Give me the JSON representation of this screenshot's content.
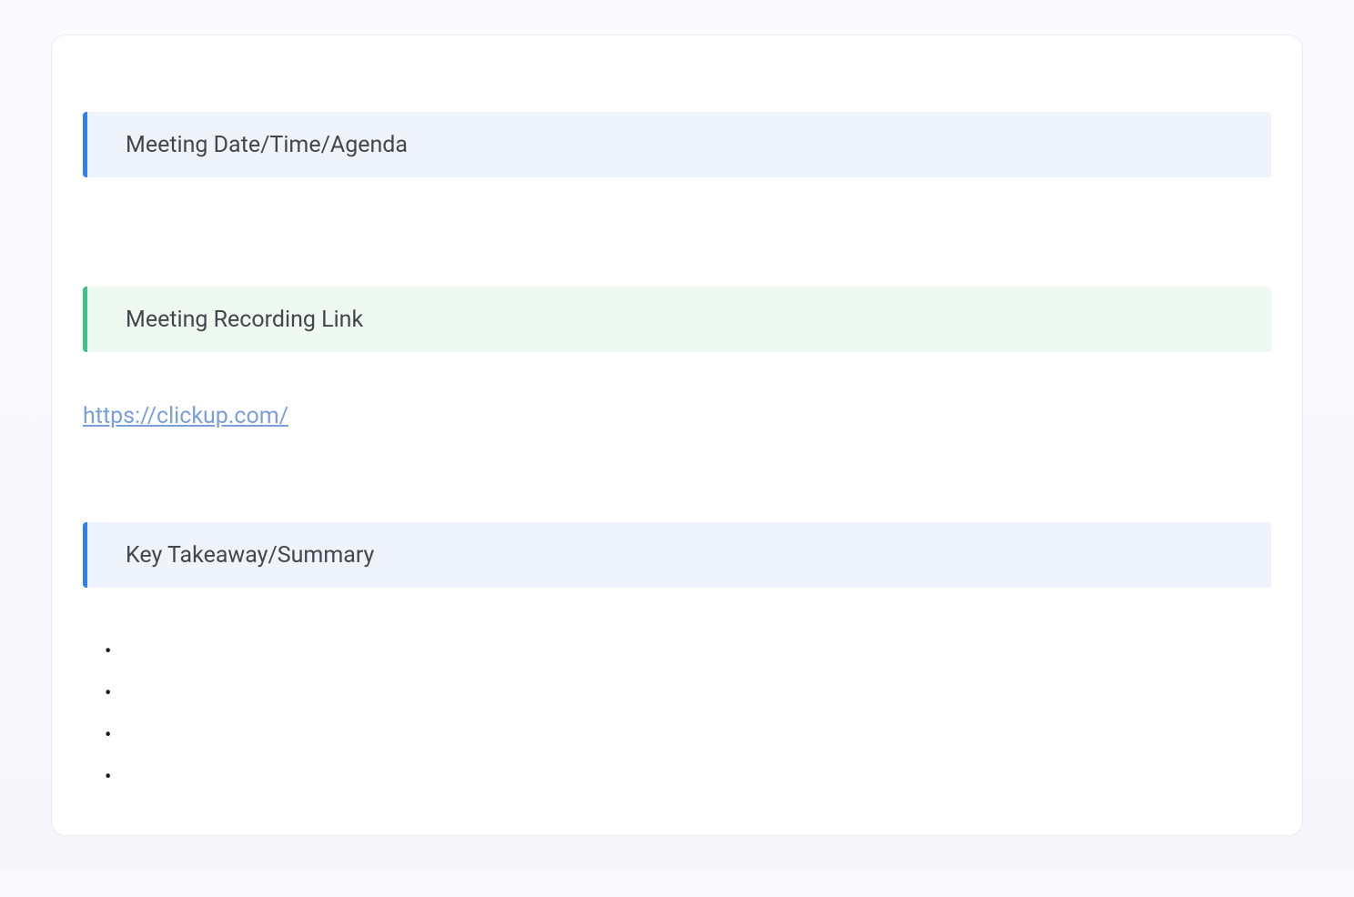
{
  "sections": {
    "meeting_info": {
      "title": "Meeting Date/Time/Agenda"
    },
    "recording": {
      "title": "Meeting Recording Link",
      "link_text": "https://clickup.com/",
      "link_href": "https://clickup.com/"
    },
    "summary": {
      "title": "Key Takeaway/Summary",
      "bullets": [
        "",
        "",
        "",
        ""
      ]
    }
  }
}
